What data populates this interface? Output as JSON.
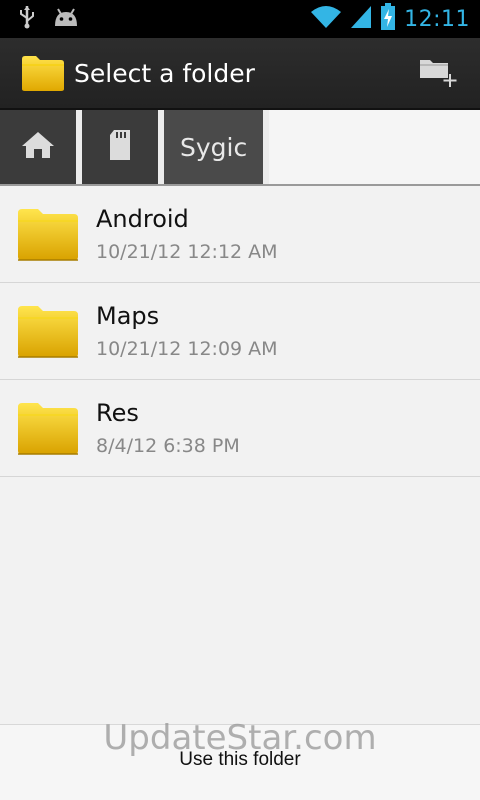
{
  "status_bar": {
    "time": "12:11",
    "icons": [
      "usb-icon",
      "android-icon",
      "wifi-icon",
      "signal-icon",
      "battery-charging-icon"
    ]
  },
  "action_bar": {
    "title": "Select a folder",
    "app_icon": "folder-icon",
    "new_folder_icon": "new-folder-icon"
  },
  "breadcrumb": {
    "home_icon": "home-icon",
    "sd_icon": "sd-card-icon",
    "current": "Sygic"
  },
  "folders": [
    {
      "name": "Android",
      "date": "10/21/12 12:12 AM"
    },
    {
      "name": "Maps",
      "date": "10/21/12 12:09 AM"
    },
    {
      "name": "Res",
      "date": "8/4/12 6:38 PM"
    }
  ],
  "bottom": {
    "use_folder_label": "Use this folder"
  },
  "watermark": "UpdateStar.com",
  "colors": {
    "clock": "#33b5e5",
    "folder": "#f5c400",
    "action_bar": "#2a2a2a"
  }
}
